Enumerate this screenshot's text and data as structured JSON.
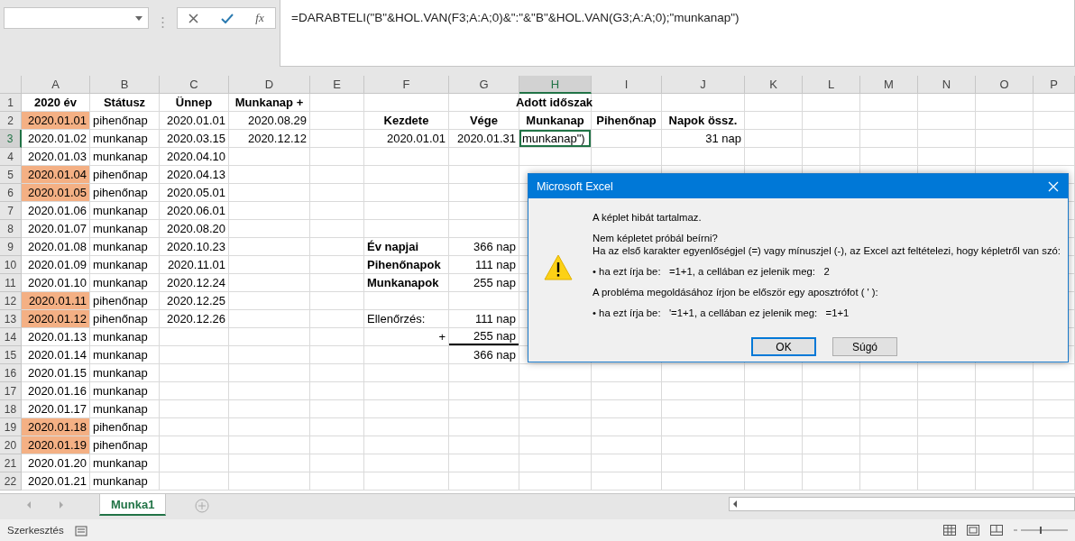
{
  "formula_bar": {
    "function_label": "fx",
    "formula": "=DARABTELI(\"B\"&HOL.VAN(F3;A:A;0)&\":\"&\"B\"&HOL.VAN(G3;A:A;0);\"munkanap\")"
  },
  "columns": [
    {
      "label": "A",
      "selected": false
    },
    {
      "label": "B",
      "selected": false
    },
    {
      "label": "C",
      "selected": false
    },
    {
      "label": "D",
      "selected": false
    },
    {
      "label": "E",
      "selected": false
    },
    {
      "label": "F",
      "selected": false
    },
    {
      "label": "G",
      "selected": false
    },
    {
      "label": "H",
      "selected": true
    },
    {
      "label": "I",
      "selected": false
    },
    {
      "label": "J",
      "selected": false
    },
    {
      "label": "K",
      "selected": false
    },
    {
      "label": "L",
      "selected": false
    },
    {
      "label": "M",
      "selected": false
    },
    {
      "label": "N",
      "selected": false
    },
    {
      "label": "O",
      "selected": false
    },
    {
      "label": "P",
      "selected": false
    }
  ],
  "rows": [
    {
      "number": "1",
      "selected": false,
      "cells": [
        {
          "text": "2020 év",
          "kind": "heading"
        },
        {
          "text": "Státusz",
          "kind": "heading"
        },
        {
          "text": "Ünnep",
          "kind": "heading"
        },
        {
          "text": "Munkanap +",
          "kind": "heading"
        },
        {},
        {
          "text": "Adott időszak",
          "kind": "group-heading"
        }
      ]
    },
    {
      "number": "2",
      "selected": false,
      "cells": [
        {
          "text": "2020.01.01",
          "kind": "value",
          "fill": true
        },
        {
          "text": "pihenőnap",
          "kind": "text"
        },
        {
          "text": "2020.01.01",
          "kind": "value"
        },
        {
          "text": "2020.08.29",
          "kind": "value"
        },
        {},
        {
          "text": "Kezdete",
          "kind": "heading"
        },
        {
          "text": "Vége",
          "kind": "heading"
        },
        {
          "text": "Munkanap",
          "kind": "heading"
        },
        {
          "text": "Pihenőnap",
          "kind": "heading"
        },
        {
          "text": "Napok össz.",
          "kind": "heading"
        }
      ]
    },
    {
      "number": "3",
      "selected": true,
      "cells": [
        {
          "text": "2020.01.02",
          "kind": "value"
        },
        {
          "text": "munkanap",
          "kind": "text"
        },
        {
          "text": "2020.03.15",
          "kind": "value"
        },
        {
          "text": "2020.12.12",
          "kind": "value"
        },
        {},
        {
          "text": "2020.01.01",
          "kind": "value"
        },
        {
          "text": "2020.01.31",
          "kind": "value"
        },
        {
          "text": "munkanap\")",
          "kind": "text",
          "selected": true
        },
        {},
        {
          "text": "31 nap",
          "kind": "value"
        }
      ]
    },
    {
      "number": "4",
      "selected": false,
      "cells": [
        {
          "text": "2020.01.03",
          "kind": "value"
        },
        {
          "text": "munkanap",
          "kind": "text"
        },
        {
          "text": "2020.04.10",
          "kind": "value"
        }
      ]
    },
    {
      "number": "5",
      "selected": false,
      "cells": [
        {
          "text": "2020.01.04",
          "kind": "value",
          "fill": true
        },
        {
          "text": "pihenőnap",
          "kind": "text"
        },
        {
          "text": "2020.04.13",
          "kind": "value"
        }
      ]
    },
    {
      "number": "6",
      "selected": false,
      "cells": [
        {
          "text": "2020.01.05",
          "kind": "value",
          "fill": true
        },
        {
          "text": "pihenőnap",
          "kind": "text"
        },
        {
          "text": "2020.05.01",
          "kind": "value"
        }
      ]
    },
    {
      "number": "7",
      "selected": false,
      "cells": [
        {
          "text": "2020.01.06",
          "kind": "value"
        },
        {
          "text": "munkanap",
          "kind": "text"
        },
        {
          "text": "2020.06.01",
          "kind": "value"
        }
      ]
    },
    {
      "number": "8",
      "selected": false,
      "cells": [
        {
          "text": "2020.01.07",
          "kind": "value"
        },
        {
          "text": "munkanap",
          "kind": "text"
        },
        {
          "text": "2020.08.20",
          "kind": "value"
        }
      ]
    },
    {
      "number": "9",
      "selected": false,
      "cells": [
        {
          "text": "2020.01.08",
          "kind": "value"
        },
        {
          "text": "munkanap",
          "kind": "text"
        },
        {
          "text": "2020.10.23",
          "kind": "value"
        },
        {},
        {},
        {
          "text": "Év napjai",
          "kind": "label"
        },
        {
          "text": "366 nap",
          "kind": "value"
        }
      ]
    },
    {
      "number": "10",
      "selected": false,
      "cells": [
        {
          "text": "2020.01.09",
          "kind": "value"
        },
        {
          "text": "munkanap",
          "kind": "text"
        },
        {
          "text": "2020.11.01",
          "kind": "value"
        },
        {},
        {},
        {
          "text": "Pihenőnapok",
          "kind": "label"
        },
        {
          "text": "111 nap",
          "kind": "value"
        }
      ]
    },
    {
      "number": "11",
      "selected": false,
      "cells": [
        {
          "text": "2020.01.10",
          "kind": "value"
        },
        {
          "text": "munkanap",
          "kind": "text"
        },
        {
          "text": "2020.12.24",
          "kind": "value"
        },
        {},
        {},
        {
          "text": "Munkanapok",
          "kind": "label"
        },
        {
          "text": "255 nap",
          "kind": "value"
        }
      ]
    },
    {
      "number": "12",
      "selected": false,
      "cells": [
        {
          "text": "2020.01.11",
          "kind": "value",
          "fill": true
        },
        {
          "text": "pihenőnap",
          "kind": "text"
        },
        {
          "text": "2020.12.25",
          "kind": "value"
        }
      ]
    },
    {
      "number": "13",
      "selected": false,
      "cells": [
        {
          "text": "2020.01.12",
          "kind": "value",
          "fill": true
        },
        {
          "text": "pihenőnap",
          "kind": "text"
        },
        {
          "text": "2020.12.26",
          "kind": "value"
        },
        {},
        {},
        {
          "text": "Ellenőrzés:",
          "kind": "text"
        },
        {
          "text": "111 nap",
          "kind": "value"
        }
      ]
    },
    {
      "number": "14",
      "selected": false,
      "cells": [
        {
          "text": "2020.01.13",
          "kind": "value"
        },
        {
          "text": "munkanap",
          "kind": "text"
        },
        {},
        {},
        {},
        {
          "text": "+",
          "kind": "value"
        },
        {
          "text": "255 nap",
          "kind": "value",
          "underline": true
        }
      ]
    },
    {
      "number": "15",
      "selected": false,
      "cells": [
        {
          "text": "2020.01.14",
          "kind": "value"
        },
        {
          "text": "munkanap",
          "kind": "text"
        },
        {},
        {},
        {},
        {},
        {
          "text": "366 nap",
          "kind": "value"
        }
      ]
    },
    {
      "number": "16",
      "selected": false,
      "cells": [
        {
          "text": "2020.01.15",
          "kind": "value"
        },
        {
          "text": "munkanap",
          "kind": "text"
        }
      ]
    },
    {
      "number": "17",
      "selected": false,
      "cells": [
        {
          "text": "2020.01.16",
          "kind": "value"
        },
        {
          "text": "munkanap",
          "kind": "text"
        }
      ]
    },
    {
      "number": "18",
      "selected": false,
      "cells": [
        {
          "text": "2020.01.17",
          "kind": "value"
        },
        {
          "text": "munkanap",
          "kind": "text"
        }
      ]
    },
    {
      "number": "19",
      "selected": false,
      "cells": [
        {
          "text": "2020.01.18",
          "kind": "value",
          "fill": true
        },
        {
          "text": "pihenőnap",
          "kind": "text"
        }
      ]
    },
    {
      "number": "20",
      "selected": false,
      "cells": [
        {
          "text": "2020.01.19",
          "kind": "value",
          "fill": true
        },
        {
          "text": "pihenőnap",
          "kind": "text"
        }
      ]
    },
    {
      "number": "21",
      "selected": false,
      "cells": [
        {
          "text": "2020.01.20",
          "kind": "value"
        },
        {
          "text": "munkanap",
          "kind": "text"
        }
      ]
    },
    {
      "number": "22",
      "selected": false,
      "cells": [
        {
          "text": "2020.01.21",
          "kind": "value"
        },
        {
          "text": "munkanap",
          "kind": "text"
        }
      ]
    }
  ],
  "dialog": {
    "title": "Microsoft Excel",
    "lines": [
      "A képlet hibát tartalmaz.",
      "Nem képletet próbál beírni?\nHa az első karakter egyenlőségjel (=) vagy mínuszjel (-), az Excel azt feltételezi, hogy képletről van szó:",
      "• ha ezt írja be:   =1+1, a cellában ez jelenik meg:   2",
      "A probléma megoldásához írjon be először egy aposztrófot ( ' ):",
      "• ha ezt írja be:   '=1+1, a cellában ez jelenik meg:   =1+1"
    ],
    "buttons": [
      {
        "label": "OK",
        "selected": true
      },
      {
        "label": "Súgó",
        "selected": false
      }
    ]
  },
  "sheet_tabs": [
    {
      "label": "Munka1",
      "selected": true
    }
  ],
  "status_bar": {
    "mode": "Szerkesztés",
    "zoom": {
      "level": 0.5
    }
  }
}
